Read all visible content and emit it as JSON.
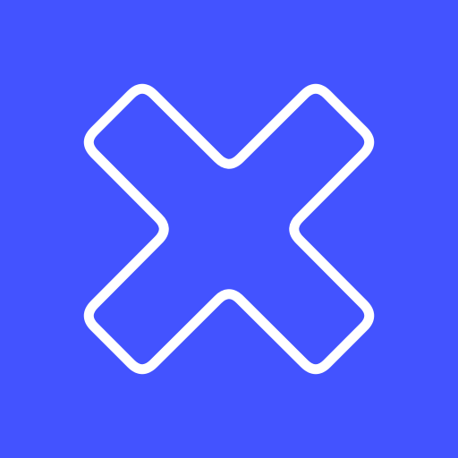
{
  "icon": {
    "name": "close-icon",
    "background_color": "#4353FF",
    "stroke_color": "#FFFFFF"
  }
}
